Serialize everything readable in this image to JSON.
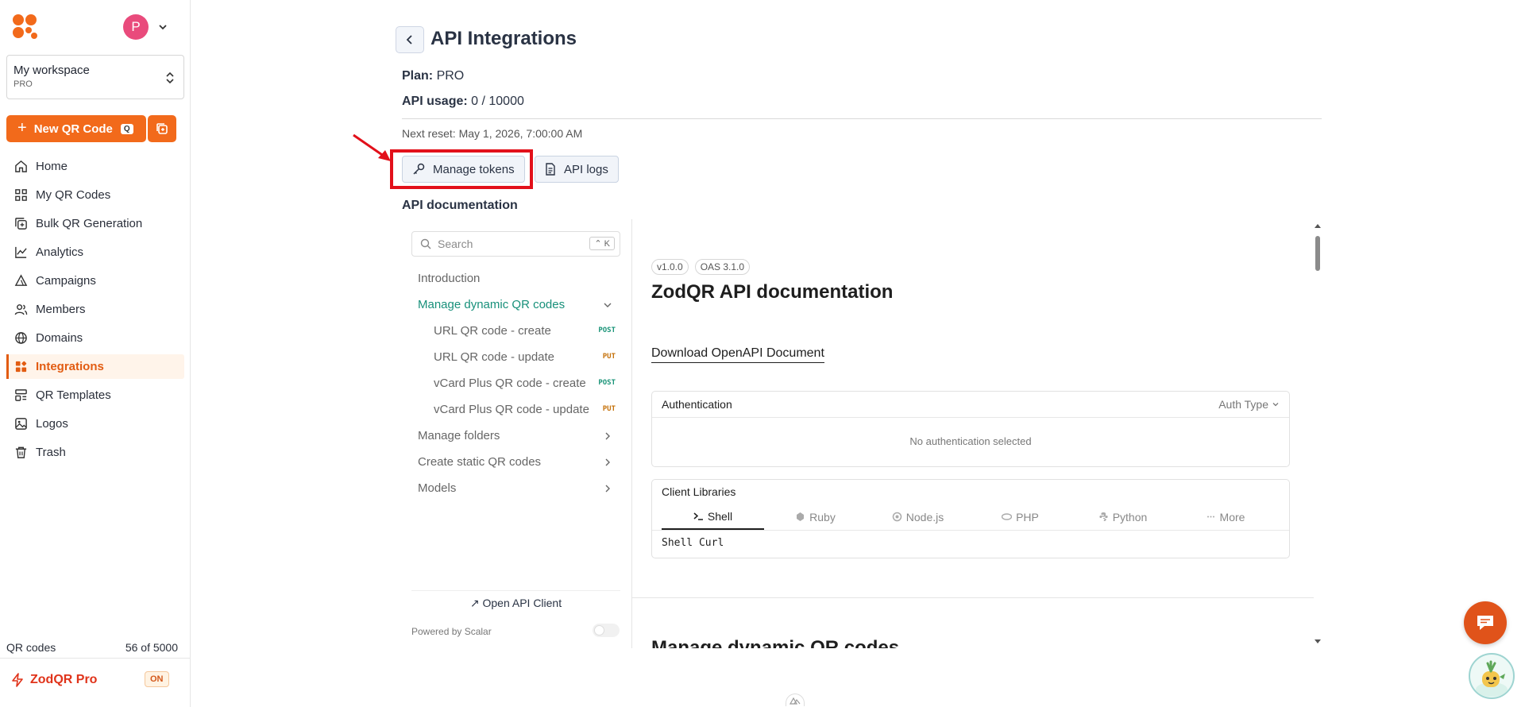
{
  "sidebar": {
    "avatar_letter": "P",
    "workspace": {
      "name": "My workspace",
      "plan": "PRO"
    },
    "new_qr": {
      "label": "New QR Code",
      "shortcut": "Q"
    },
    "items": [
      {
        "label": "Home",
        "icon": "home-icon"
      },
      {
        "label": "My QR Codes",
        "icon": "qr-grid-icon"
      },
      {
        "label": "Bulk QR Generation",
        "icon": "bulk-add-icon"
      },
      {
        "label": "Analytics",
        "icon": "chart-icon"
      },
      {
        "label": "Campaigns",
        "icon": "campaign-icon"
      },
      {
        "label": "Members",
        "icon": "users-icon"
      },
      {
        "label": "Domains",
        "icon": "globe-icon"
      },
      {
        "label": "Integrations",
        "icon": "integrations-icon",
        "active": true
      },
      {
        "label": "QR Templates",
        "icon": "templates-icon"
      },
      {
        "label": "Logos",
        "icon": "image-icon"
      },
      {
        "label": "Trash",
        "icon": "trash-icon"
      }
    ],
    "qr_codes_label": "QR codes",
    "qr_codes_count": "56 of 5000",
    "pro_label": "ZodQR Pro",
    "pro_status": "ON"
  },
  "main": {
    "title": "API Integrations",
    "plan_label": "Plan:",
    "plan_value": "PRO",
    "usage_label": "API usage:",
    "usage_value": "0 / 10000",
    "next_reset": "Next reset: May 1, 2026, 7:00:00 AM",
    "manage_tokens": "Manage tokens",
    "api_logs": "API logs",
    "doc_section_title": "API documentation"
  },
  "docs": {
    "search_placeholder": "Search",
    "search_shortcut": "⌃ K",
    "nav": {
      "introduction": "Introduction",
      "manage_dynamic": "Manage dynamic QR codes",
      "url_create": "URL QR code - create",
      "url_update": "URL QR code - update",
      "vcard_create": "vCard Plus QR code - create",
      "vcard_update": "vCard Plus QR code - update",
      "manage_folders": "Manage folders",
      "create_static": "Create static QR codes",
      "models": "Models",
      "post": "POST",
      "put": "PUT"
    },
    "open_client": "↗ Open API Client",
    "powered_by": "Powered by Scalar",
    "version_badge": "v1.0.0",
    "oas_badge": "OAS 3.1.0",
    "api_title": "ZodQR API documentation",
    "download_link": "Download OpenAPI Document",
    "auth": {
      "label": "Authentication",
      "type": "Auth Type",
      "empty": "No authentication selected"
    },
    "clients": {
      "label": "Client Libraries",
      "tabs": [
        "Shell",
        "Ruby",
        "Node.js",
        "PHP",
        "Python",
        "More"
      ],
      "selected": "Shell Curl"
    },
    "next_section": "Manage dynamic QR codes"
  },
  "colors": {
    "accent": "#f26a1b",
    "active_bg": "#fff4ea",
    "docs_accent": "#17907a",
    "highlight": "#e2101a"
  }
}
